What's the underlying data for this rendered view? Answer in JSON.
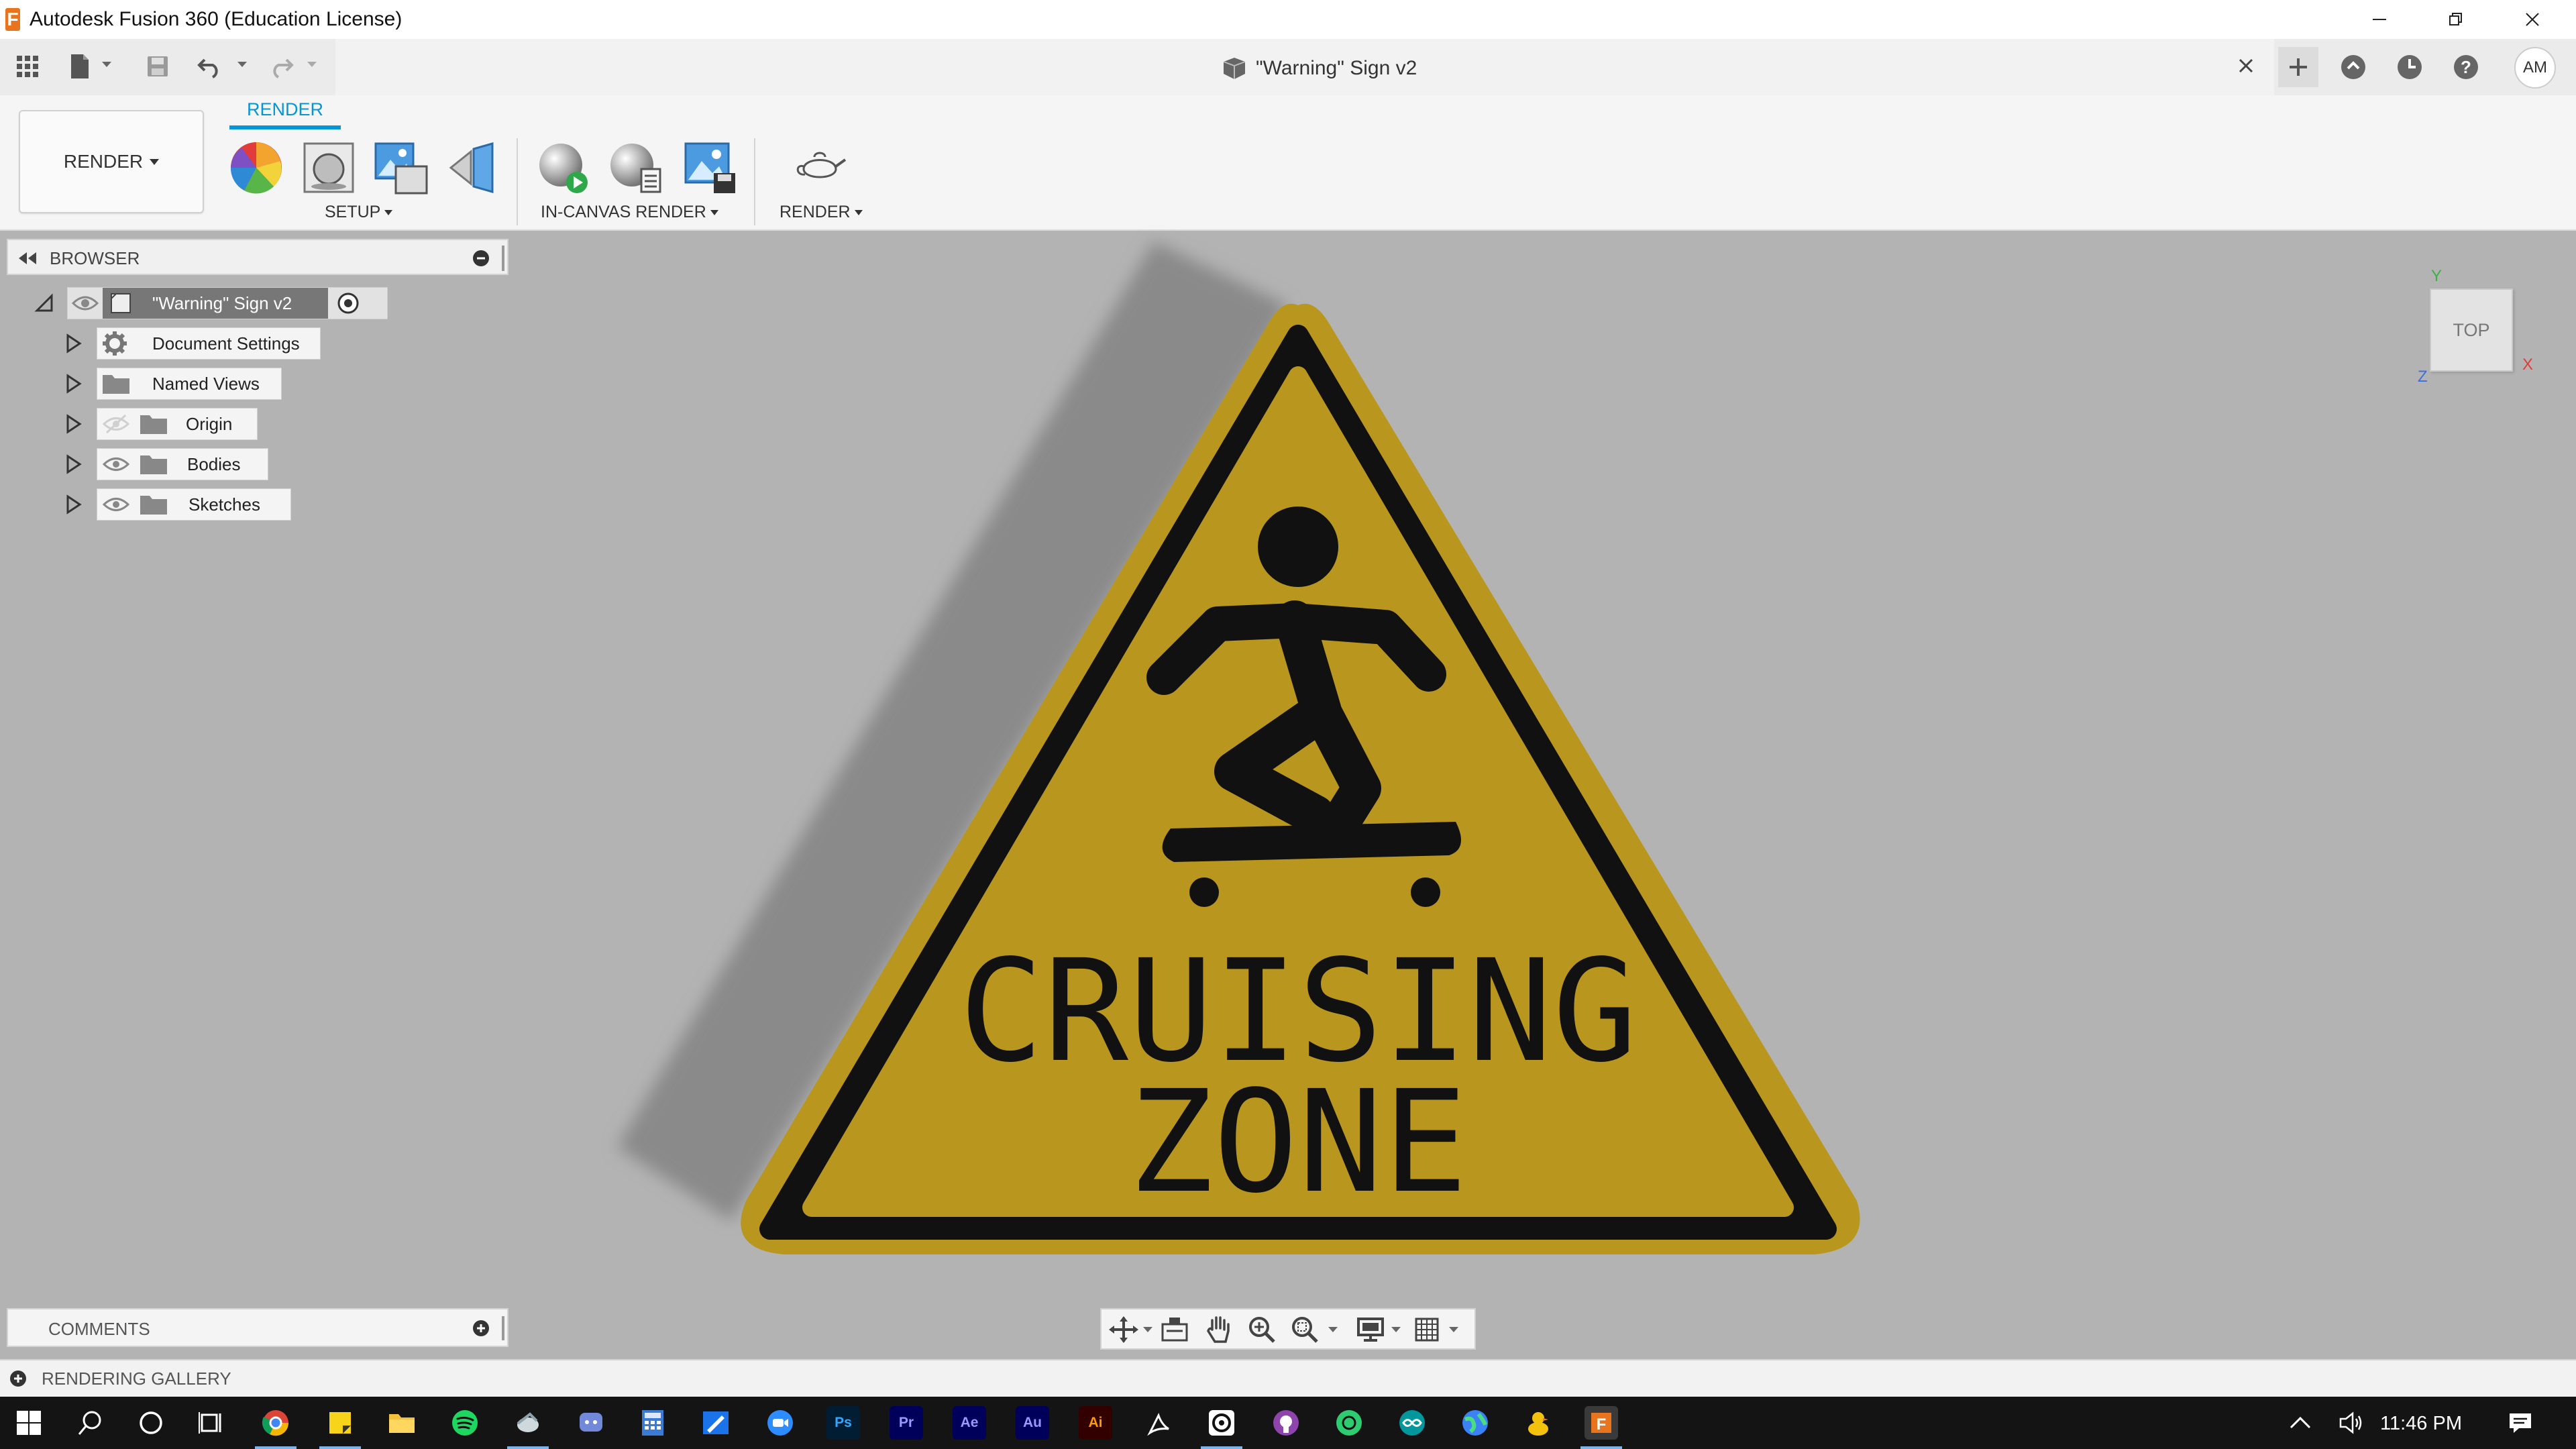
{
  "window": {
    "title": "Autodesk Fusion 360 (Education License)",
    "logo_letter": "F"
  },
  "document_tab": {
    "title": "\"Warning\" Sign v2"
  },
  "user": {
    "initials": "AM"
  },
  "toolbar": {
    "workspace_label": "RENDER",
    "active_tab": "RENDER",
    "groups": {
      "setup": "SETUP",
      "in_canvas_render": "IN-CANVAS RENDER",
      "render": "RENDER"
    }
  },
  "browser": {
    "title": "BROWSER",
    "root": {
      "label": "\"Warning\" Sign v2"
    },
    "items": [
      {
        "label": "Document Settings",
        "icon": "gear-icon"
      },
      {
        "label": "Named Views",
        "icon": "folder-icon"
      },
      {
        "label": "Origin",
        "icon": "folder-icon",
        "visibility": "hidden"
      },
      {
        "label": "Bodies",
        "icon": "folder-icon",
        "visibility": "visible"
      },
      {
        "label": "Sketches",
        "icon": "folder-icon",
        "visibility": "visible"
      }
    ]
  },
  "viewport": {
    "sign_line1": "CRUISING",
    "sign_line2": "ZONE",
    "sign_color": "#b9971e",
    "viewcube_face": "TOP",
    "axes": {
      "y": "Y",
      "x": "X",
      "z": "Z"
    }
  },
  "panels": {
    "comments": "COMMENTS",
    "rendering_gallery": "RENDERING GALLERY"
  },
  "taskbar": {
    "apps": [
      "Ps",
      "Pr",
      "Ae",
      "Au",
      "Ai"
    ],
    "clock": "11:46 PM"
  },
  "colors": {
    "accent": "#0696d7",
    "viewport_bg": "#b3b3b3",
    "sign_yellow": "#b9971e",
    "taskbar_bg": "#141414"
  }
}
